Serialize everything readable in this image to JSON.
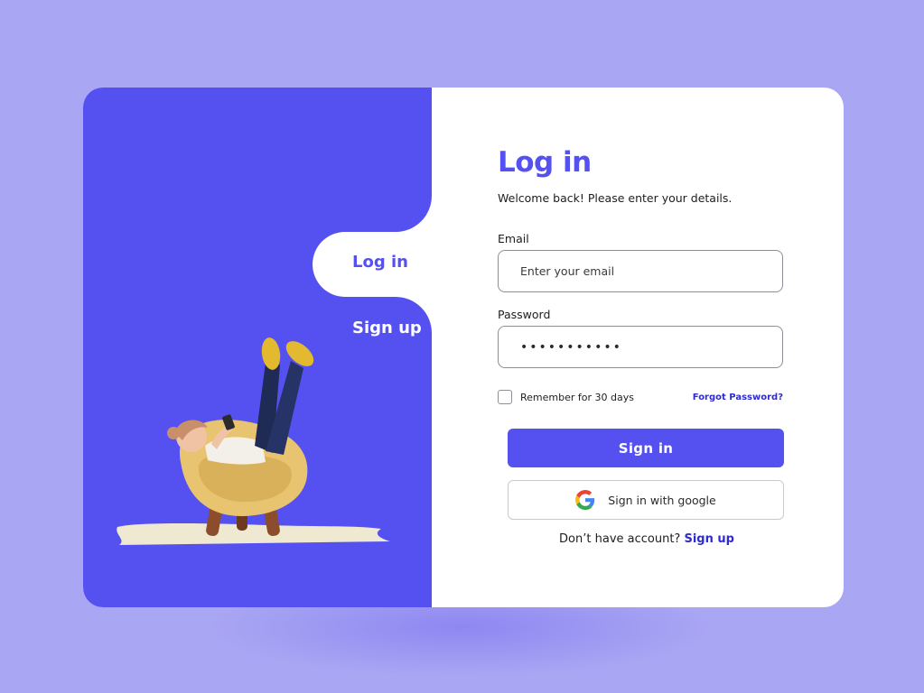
{
  "colors": {
    "background": "#a9a6f3",
    "accent": "#5551f0",
    "link": "#2f2bcf",
    "card": "#ffffff"
  },
  "tabs": {
    "login_label": "Log in",
    "signup_label": "Sign up"
  },
  "illustration": {
    "icon": "person-relaxing-in-armchair-illustration"
  },
  "form": {
    "title": "Log in",
    "subtitle": "Welcome back! Please enter your details.",
    "email_label": "Email",
    "email_placeholder": "Enter your email",
    "password_label": "Password",
    "password_value": "•••••••••••",
    "remember_label": "Remember for 30 days",
    "forgot_label": "Forgot Password?",
    "signin_label": "Sign in",
    "google_label": "Sign in with google",
    "google_icon": "google-icon",
    "no_account_text": "Don’t have account?",
    "signup_link": "Sign up"
  }
}
